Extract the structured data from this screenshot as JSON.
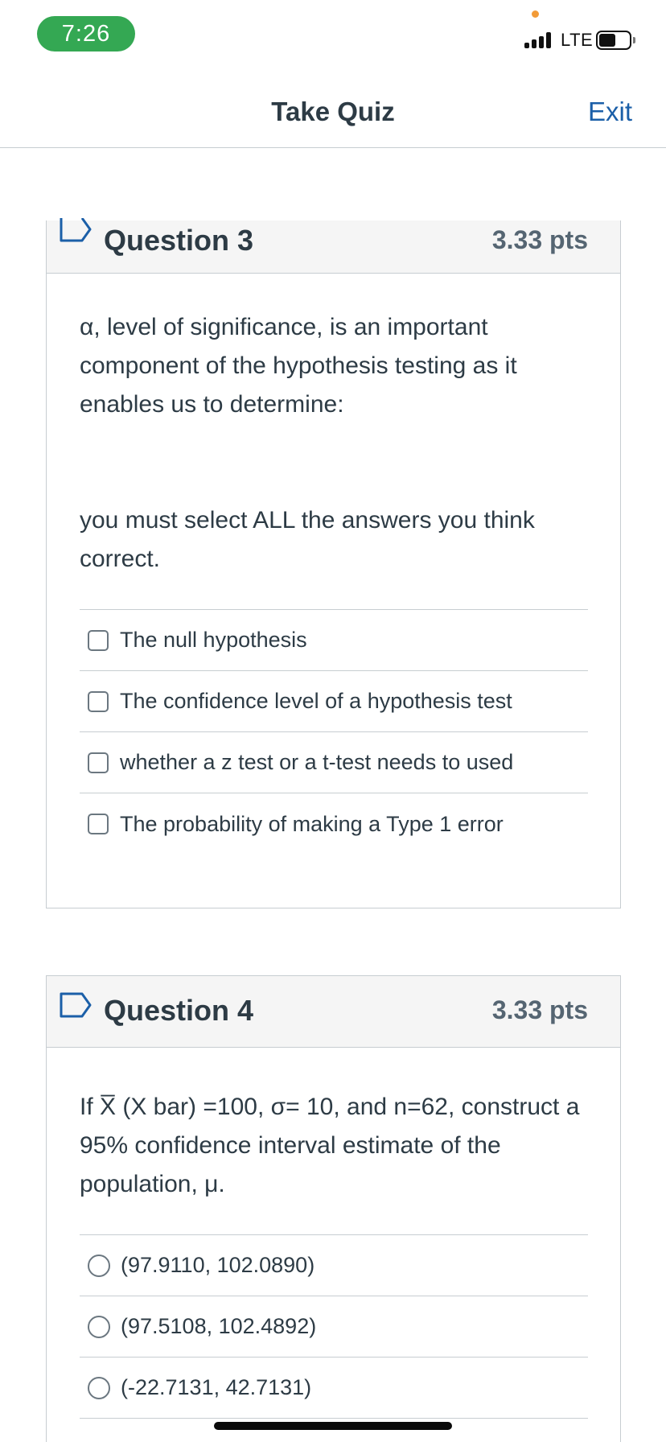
{
  "status_bar": {
    "time": "7:26",
    "network": "LTE",
    "time_pill_color": "#34a853"
  },
  "header": {
    "title": "Take Quiz",
    "exit_label": "Exit",
    "exit_color": "#1b5fa8"
  },
  "questions": [
    {
      "title": "Question 3",
      "points": "3.33 pts",
      "text": "α, level of significance, is an important component of the hypothesis testing as it enables us to determine:",
      "instruction": "you must select ALL the answers you think correct.",
      "answer_type": "checkbox",
      "answers": [
        {
          "label": "The null hypothesis",
          "selected": false
        },
        {
          "label": "The confidence level of a hypothesis test",
          "selected": false
        },
        {
          "label": "whether a z test or a t-test needs to used",
          "selected": false
        },
        {
          "label": "The probability of making a Type 1 error",
          "selected": false
        }
      ]
    },
    {
      "title": "Question 4",
      "points": "3.33 pts",
      "text": "If X̅ (X bar) =100, σ= 10, and n=62, construct a 95% confidence interval estimate of the population, μ.",
      "answer_type": "radio",
      "answers": [
        {
          "label": "(97.9110, 102.0890)",
          "selected": false
        },
        {
          "label": "(97.5108, 102.4892)",
          "selected": false
        },
        {
          "label": "(-22.7131, 42.7131)",
          "selected": false
        }
      ]
    }
  ],
  "icons": {
    "flag": "bookmark-flag-icon",
    "signal": "cellular-signal-icon",
    "battery": "battery-icon"
  }
}
